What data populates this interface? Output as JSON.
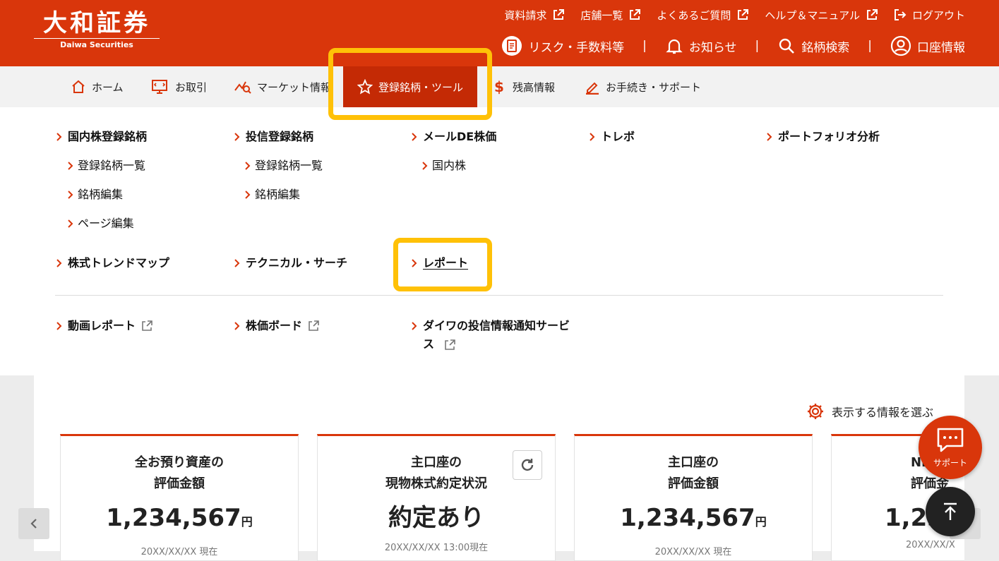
{
  "logo": {
    "main": "大和証券",
    "sub": "Daiwa Securities"
  },
  "utility_links": [
    {
      "label": "資料請求",
      "icon": "external-link-icon"
    },
    {
      "label": "店舗一覧",
      "icon": "external-link-icon"
    },
    {
      "label": "よくあるご質問",
      "icon": "external-link-icon"
    },
    {
      "label": "ヘルプ＆マニュアル",
      "icon": "external-link-icon"
    },
    {
      "label": "ログアウト",
      "icon": "logout-icon"
    }
  ],
  "secondary_nav": [
    {
      "label": "リスク・手数料等",
      "icon": "document-icon"
    },
    {
      "label": "お知らせ",
      "icon": "bell-icon"
    },
    {
      "label": "銘柄検索",
      "icon": "search-icon"
    },
    {
      "label": "口座情報",
      "icon": "user-icon"
    }
  ],
  "separator": "|",
  "tabs": [
    {
      "label": "ホーム",
      "icon": "home-icon"
    },
    {
      "label": "お取引",
      "icon": "trade-icon"
    },
    {
      "label": "マーケット情報",
      "icon": "market-icon"
    },
    {
      "label": "登録銘柄・ツール",
      "icon": "star-icon",
      "active": true
    },
    {
      "label": "残高情報",
      "icon": "dollar-icon"
    },
    {
      "label": "お手続き・サポート",
      "icon": "pencil-icon"
    }
  ],
  "menu": {
    "domestic": {
      "title": "国内株登録銘柄",
      "items": [
        "登録銘柄一覧",
        "銘柄編集",
        "ページ編集"
      ]
    },
    "fund": {
      "title": "投信登録銘柄",
      "items": [
        "登録銘柄一覧",
        "銘柄編集"
      ]
    },
    "mail": {
      "title": "メールDE株価",
      "items": [
        "国内株"
      ]
    },
    "trebo": {
      "title": "トレボ"
    },
    "portfolio": {
      "title": "ポートフォリオ分析"
    },
    "trend": {
      "title": "株式トレンドマップ"
    },
    "technical": {
      "title": "テクニカル・サーチ"
    },
    "report": {
      "title": "レポート"
    },
    "video": {
      "title": "動画レポート"
    },
    "board": {
      "title": "株価ボード"
    },
    "notify": {
      "title_line1": "ダイワの投信情報通知サービ",
      "title_line2": "ス"
    }
  },
  "select_info": "表示する情報を選ぶ",
  "cards": [
    {
      "title_line1": "全お預り資産の",
      "title_line2": "評価金額",
      "value": "1,234,567",
      "unit": "円",
      "date": "20XX/XX/XX 現在"
    },
    {
      "title_line1": "主口座の",
      "title_line2": "現物株式約定状況",
      "value": "約定あり",
      "unit": "",
      "date": "20XX/XX/XX 13:00現在"
    },
    {
      "title_line1": "主口座の",
      "title_line2": "評価金額",
      "value": "1,234,567",
      "unit": "円",
      "date": "20XX/XX/XX 現在"
    },
    {
      "title_line1": "NI",
      "title_line2": "評価金",
      "value": "1,234",
      "unit": "",
      "date": "20XX/XX/X"
    }
  ],
  "support_label": "サポート",
  "colors": {
    "brand": "#d9360b",
    "active_tab": "#c42a05",
    "highlight": "#ffc107"
  }
}
